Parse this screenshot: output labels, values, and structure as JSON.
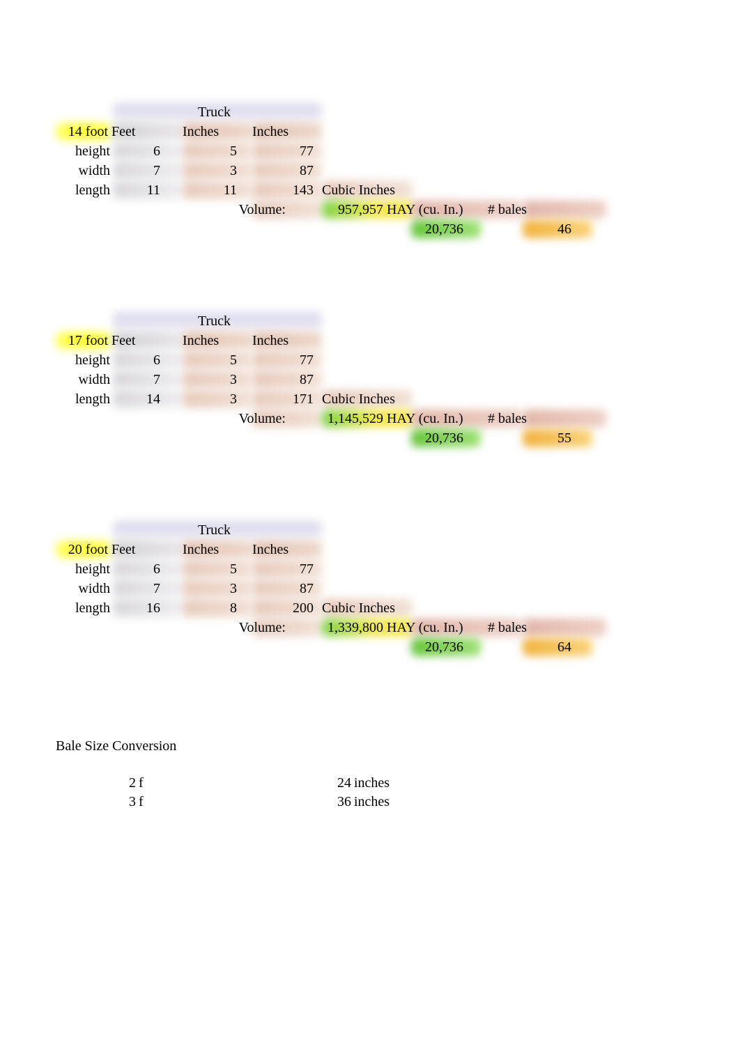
{
  "trucks": [
    {
      "size": "14 foot",
      "header": "Truck",
      "col_feet": "Feet",
      "col_inches1": "Inches",
      "col_inches2": "Inches",
      "rows": [
        {
          "label": "height",
          "feet": "6",
          "inches": "5",
          "total": "77"
        },
        {
          "label": "width",
          "feet": "7",
          "inches": "3",
          "total": "87"
        },
        {
          "label": "length",
          "feet": "11",
          "inches": "11",
          "total": "143",
          "unit": "Cubic Inches"
        }
      ],
      "volume_label": "Volume:",
      "volume": "957,957",
      "hay_label": "HAY (cu. In.)",
      "bales_label": "# bales",
      "hay_value": "20,736",
      "bales_value": "46"
    },
    {
      "size": "17 foot",
      "header": "Truck",
      "col_feet": "Feet",
      "col_inches1": "Inches",
      "col_inches2": "Inches",
      "rows": [
        {
          "label": "height",
          "feet": "6",
          "inches": "5",
          "total": "77"
        },
        {
          "label": "width",
          "feet": "7",
          "inches": "3",
          "total": "87"
        },
        {
          "label": "length",
          "feet": "14",
          "inches": "3",
          "total": "171",
          "unit": "Cubic Inches"
        }
      ],
      "volume_label": "Volume:",
      "volume": "1,145,529",
      "hay_label": "HAY (cu. In.)",
      "bales_label": "# bales",
      "hay_value": "20,736",
      "bales_value": "55"
    },
    {
      "size": "20 foot",
      "header": "Truck",
      "col_feet": "Feet",
      "col_inches1": "Inches",
      "col_inches2": "Inches",
      "rows": [
        {
          "label": "height",
          "feet": "6",
          "inches": "5",
          "total": "77"
        },
        {
          "label": "width",
          "feet": "7",
          "inches": "3",
          "total": "87"
        },
        {
          "label": "length",
          "feet": "16",
          "inches": "8",
          "total": "200",
          "unit": "Cubic Inches"
        }
      ],
      "volume_label": "Volume:",
      "volume": "1,339,800",
      "hay_label": "HAY (cu. In.)",
      "bales_label": "# bales",
      "hay_value": "20,736",
      "bales_value": "64"
    }
  ],
  "bale": {
    "title": "Bale Size Conversion",
    "rows": [
      {
        "a": "2",
        "au": "f",
        "b": "24",
        "bu": "inches"
      },
      {
        "a": "3",
        "au": "f",
        "b": "36",
        "bu": "inches"
      }
    ]
  }
}
